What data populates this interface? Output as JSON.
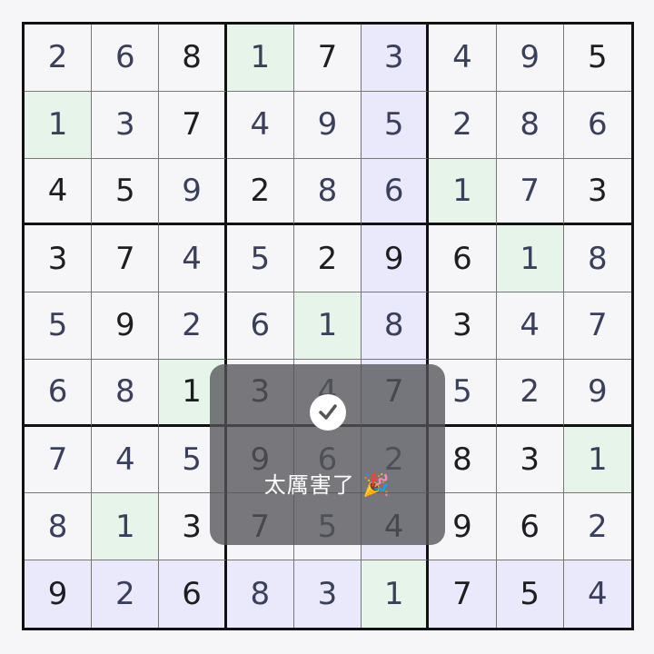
{
  "grid": [
    [
      "2",
      "6",
      "8",
      "1",
      "7",
      "3",
      "4",
      "9",
      "5"
    ],
    [
      "1",
      "3",
      "7",
      "4",
      "9",
      "5",
      "2",
      "8",
      "6"
    ],
    [
      "4",
      "5",
      "9",
      "2",
      "8",
      "6",
      "1",
      "7",
      "3"
    ],
    [
      "3",
      "7",
      "4",
      "5",
      "2",
      "9",
      "6",
      "1",
      "8"
    ],
    [
      "5",
      "9",
      "2",
      "6",
      "1",
      "8",
      "3",
      "4",
      "7"
    ],
    [
      "6",
      "8",
      "1",
      "3",
      "4",
      "7",
      "5",
      "2",
      "9"
    ],
    [
      "7",
      "4",
      "5",
      "9",
      "6",
      "2",
      "8",
      "3",
      "1"
    ],
    [
      "8",
      "1",
      "3",
      "7",
      "5",
      "4",
      "9",
      "6",
      "2"
    ],
    [
      "9",
      "2",
      "6",
      "8",
      "3",
      "1",
      "7",
      "5",
      "4"
    ]
  ],
  "given": [
    [
      0,
      0,
      1,
      0,
      1,
      0,
      0,
      0,
      1
    ],
    [
      0,
      0,
      1,
      0,
      0,
      0,
      0,
      0,
      0
    ],
    [
      1,
      1,
      0,
      1,
      0,
      0,
      0,
      0,
      1
    ],
    [
      1,
      1,
      0,
      0,
      1,
      1,
      1,
      0,
      0
    ],
    [
      0,
      1,
      0,
      0,
      0,
      0,
      1,
      0,
      0
    ],
    [
      0,
      0,
      1,
      1,
      0,
      1,
      0,
      0,
      0
    ],
    [
      0,
      0,
      0,
      1,
      0,
      0,
      1,
      1,
      0
    ],
    [
      0,
      0,
      1,
      1,
      0,
      1,
      1,
      1,
      0
    ],
    [
      1,
      0,
      1,
      0,
      0,
      0,
      1,
      1,
      0
    ]
  ],
  "highlight_digit": "1",
  "highlight_column": 5,
  "highlight_row": 8,
  "colors": {
    "match_highlight": "#e6f4ea",
    "line_highlight": "#e9e9fb",
    "given_text": "#1e1e22",
    "entered_text": "#3a3f5c"
  },
  "toast": {
    "icon": "checkmark-icon",
    "message": "太厲害了 🎉"
  }
}
